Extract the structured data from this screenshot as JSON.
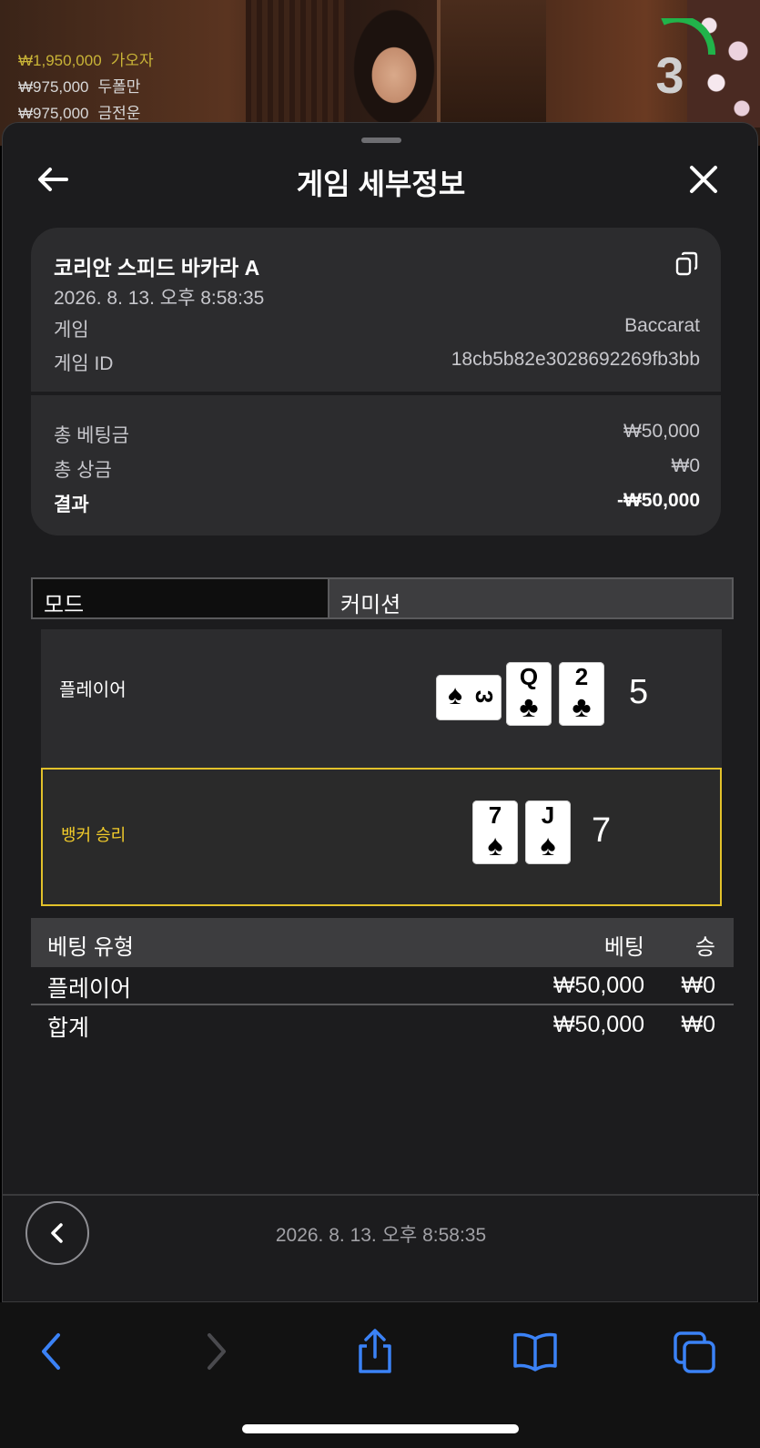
{
  "video": {
    "winners": [
      {
        "amount": "₩1,950,000",
        "name": "가오자"
      },
      {
        "amount": "₩975,000",
        "name": "두폴만"
      },
      {
        "amount": "₩975,000",
        "name": "금전운"
      }
    ],
    "countdown": "3",
    "countdown_color": "#21b34a"
  },
  "sheet": {
    "title": "게임 세부정보",
    "info": {
      "table_name": "코리안 스피드 바카라 A",
      "datetime": "2026. 8. 13. 오후 8:58:35",
      "game_label": "게임",
      "game_value": "Baccarat",
      "game_id_label": "게임 ID",
      "game_id_value": "18cb5b82e3028692269fb3bb",
      "total_bet_label": "총 베팅금",
      "total_bet_value": "₩50,000",
      "total_win_label": "총 상금",
      "total_win_value": "₩0",
      "result_label": "결과",
      "result_value": "-₩50,000"
    },
    "tabs": {
      "mode": "모드",
      "commission": "커미션"
    },
    "player": {
      "label": "플레이어",
      "score": "5",
      "cards": [
        {
          "rank": "3",
          "suit": "♠",
          "rotated": true
        },
        {
          "rank": "Q",
          "suit": "♣"
        },
        {
          "rank": "2",
          "suit": "♣"
        }
      ]
    },
    "banker": {
      "label": "뱅커 승리",
      "score": "7",
      "highlight_color": "#e2c12a",
      "cards": [
        {
          "rank": "7",
          "suit": "♠"
        },
        {
          "rank": "J",
          "suit": "♠"
        }
      ]
    },
    "bets": {
      "headers": {
        "type": "베팅 유형",
        "bet": "베팅",
        "win": "승"
      },
      "rows": [
        {
          "type": "플레이어",
          "bet": "₩50,000",
          "win": "₩0"
        }
      ],
      "total": {
        "type": "합계",
        "bet": "₩50,000",
        "win": "₩0"
      }
    },
    "footer_datetime": "2026. 8. 13. 오후 8:58:35"
  },
  "toolbar": {
    "accent": "#3b82f6",
    "icons": [
      "back-icon",
      "forward-icon",
      "share-icon",
      "bookmarks-icon",
      "tabs-icon"
    ]
  }
}
